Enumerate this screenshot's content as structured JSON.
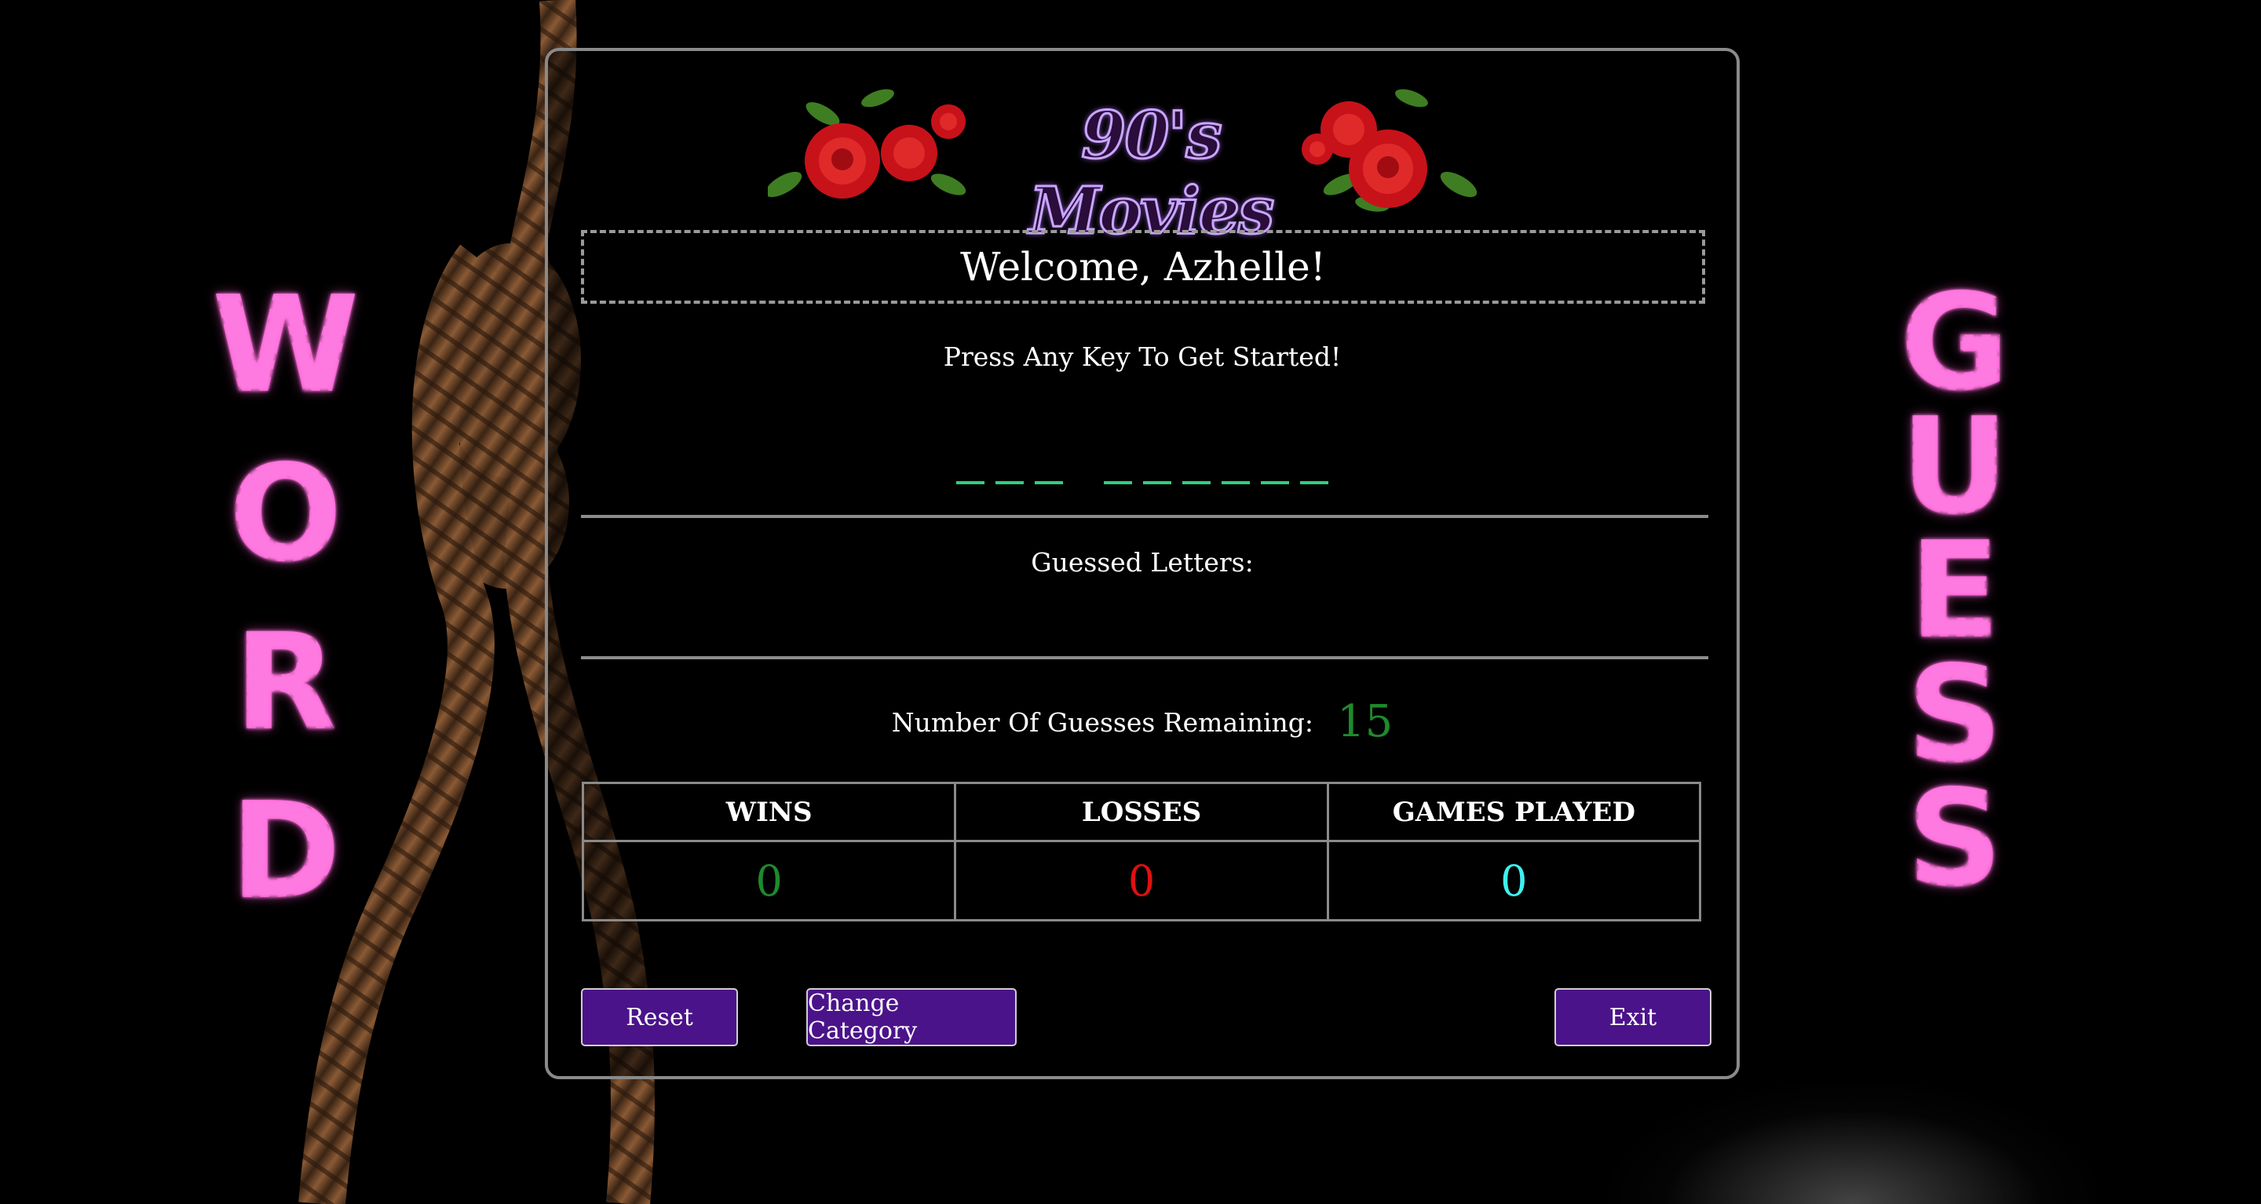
{
  "branding": {
    "left_word": [
      "W",
      "O",
      "R",
      "D"
    ],
    "right_word": [
      "G",
      "U",
      "E",
      "S",
      "S"
    ],
    "category_title": "90's Movies"
  },
  "game": {
    "welcome": "Welcome, Azhelle!",
    "prompt": "Press Any Key To Get Started!",
    "word_pattern": [
      3,
      6
    ],
    "guessed_label": "Guessed Letters:",
    "remaining_label": "Number Of Guesses Remaining:",
    "remaining_value": "15"
  },
  "stats": {
    "headers": [
      "WINS",
      "LOSSES",
      "GAMES PLAYED"
    ],
    "values": [
      "0",
      "0",
      "0"
    ]
  },
  "buttons": {
    "reset": "Reset",
    "change_category": "Change Category",
    "exit": "Exit"
  },
  "colors": {
    "button_bg": "#4b138a",
    "wins": "#1e8a2c",
    "losses": "#e01010",
    "games_played": "#3ff0f0",
    "blank": "#2ecf7b",
    "marquee": "#e64fc7"
  }
}
